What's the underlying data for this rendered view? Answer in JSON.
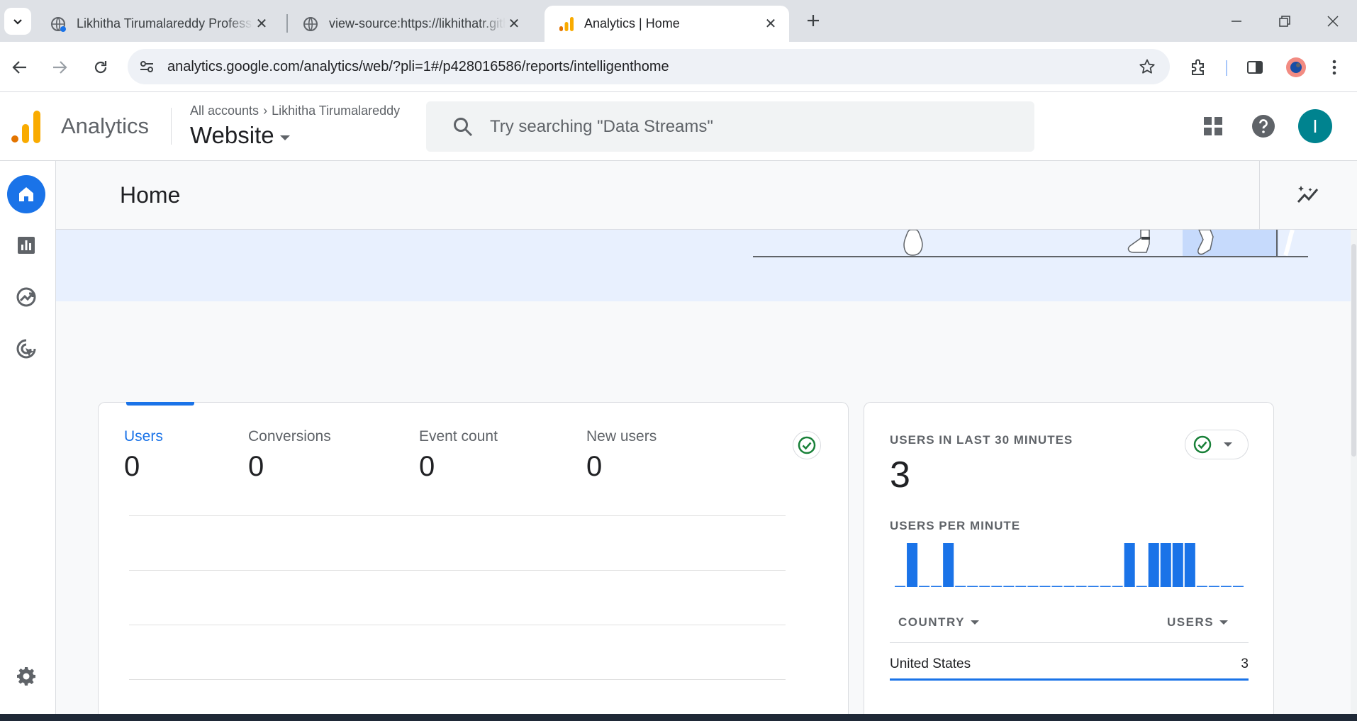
{
  "browser": {
    "tabs": [
      {
        "title": "Likhitha Tirumalareddy Professional",
        "active": false
      },
      {
        "title": "view-source:https://likhithatr.github.io",
        "active": false
      },
      {
        "title": "Analytics | Home",
        "active": true
      }
    ],
    "url": "analytics.google.com/analytics/web/?pli=1#/p428016586/reports/intelligenthome"
  },
  "header": {
    "product_name": "Analytics",
    "breadcrumb_root": "All accounts",
    "breadcrumb_account": "Likhitha Tirumalareddy",
    "property": "Website",
    "search_placeholder": "Try searching \"Data Streams\"",
    "avatar_initial": "I"
  },
  "page": {
    "title": "Home"
  },
  "metrics_card": {
    "metrics": [
      {
        "label": "Users",
        "value": "0",
        "selected": true
      },
      {
        "label": "Conversions",
        "value": "0"
      },
      {
        "label": "Event count",
        "value": "0"
      },
      {
        "label": "New users",
        "value": "0"
      }
    ]
  },
  "realtime_card": {
    "title": "USERS IN LAST 30 MINUTES",
    "value": "3",
    "per_minute_label": "USERS PER MINUTE",
    "per_minute_values": [
      0,
      1,
      0,
      0,
      1,
      0,
      0,
      0,
      0,
      0,
      0,
      0,
      0,
      0,
      0,
      0,
      0,
      0,
      0,
      1,
      0,
      1,
      1,
      1,
      1,
      0,
      0,
      0,
      0
    ],
    "col_country": "COUNTRY",
    "col_users": "USERS",
    "rows": [
      {
        "country": "United States",
        "users": "3"
      }
    ]
  },
  "colors": {
    "accent": "#1a73e8",
    "success": "#188038",
    "logo_orange": "#f9ab00",
    "logo_dark_orange": "#e37400"
  }
}
